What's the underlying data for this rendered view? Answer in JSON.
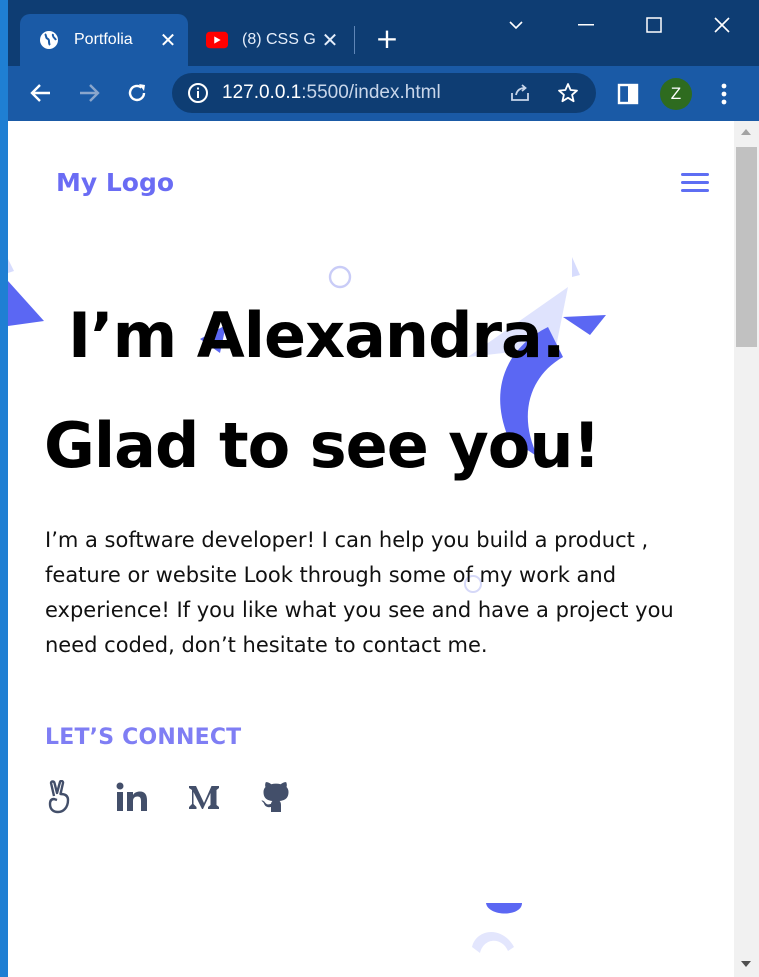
{
  "browser": {
    "tabs": [
      {
        "label": "Portfolia",
        "icon": "globe-icon",
        "active": true
      },
      {
        "label": "(8) CSS G",
        "icon": "youtube-icon",
        "active": false
      }
    ],
    "url_host": "127.0.0.1",
    "url_rest": ":5500/index.html",
    "profile_initial": "Z"
  },
  "page": {
    "logo": "My Logo",
    "headline_line1": "I’m Alexandra.",
    "headline_line2": "Glad to see you!",
    "intro": "I’m a software developer! I can help you build a product , feature or website Look through some of my work and experience! If you like what you see and have a project you need coded, don’t hesitate to contact me.",
    "connect_label": "LET’S CONNECT",
    "socials": [
      "angellist-icon",
      "linkedin-icon",
      "medium-icon",
      "github-icon"
    ]
  },
  "colors": {
    "brand": "#6a6cf4",
    "titlebar": "#0e3d73",
    "toolbar": "#1a5aa6"
  }
}
